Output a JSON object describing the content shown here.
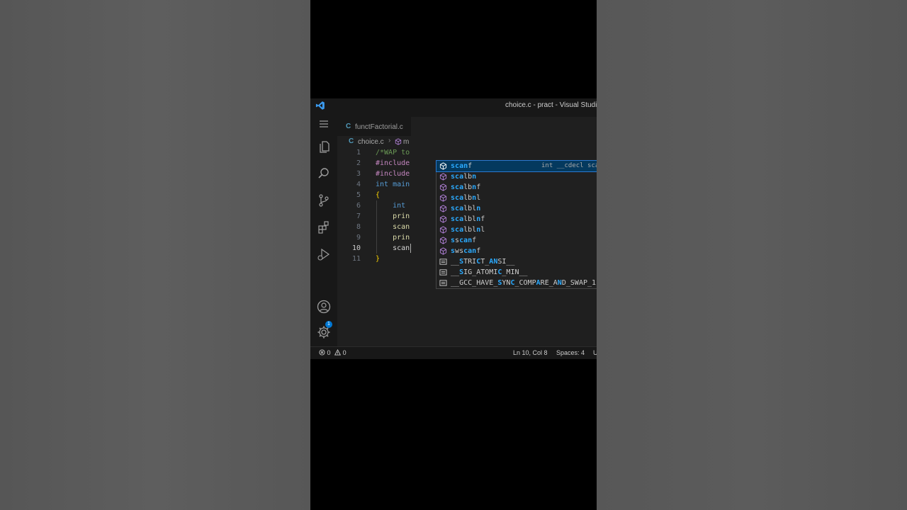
{
  "window": {
    "title": "choice.c - pract - Visual Studio"
  },
  "activity_bar": {
    "items": [
      "files-icon",
      "search-icon",
      "source-control-icon",
      "extensions-icon",
      "run-debug-icon"
    ],
    "bottom_items": [
      "accounts-icon",
      "settings-gear-icon"
    ],
    "accounts_badge": "1"
  },
  "tabs": [
    {
      "label": "functFactorial.c",
      "lang_icon": "C"
    }
  ],
  "breadcrumb": {
    "lang_icon": "C",
    "file": "choice.c",
    "separator": "›",
    "symbol": "m"
  },
  "editor": {
    "lines": [
      {
        "num": "1",
        "text": "/*WAP to"
      },
      {
        "num": "2",
        "text": "#include"
      },
      {
        "num": "3",
        "text": "#include"
      },
      {
        "num": "4",
        "text": "int main"
      },
      {
        "num": "5",
        "text": "{"
      },
      {
        "num": "6",
        "text": "    int"
      },
      {
        "num": "7",
        "text": "    prin"
      },
      {
        "num": "8",
        "text": "    scan"
      },
      {
        "num": "9",
        "text": "    prin"
      },
      {
        "num": "10",
        "text": "    scan"
      },
      {
        "num": "11",
        "text": "}"
      }
    ],
    "active_line": "10"
  },
  "suggestions": {
    "items": [
      {
        "label": "scanf",
        "kind": "function",
        "selected": true
      },
      {
        "label": "scalbn",
        "kind": "function"
      },
      {
        "label": "scalbnf",
        "kind": "function"
      },
      {
        "label": "scalbnl",
        "kind": "function"
      },
      {
        "label": "scalbln",
        "kind": "function"
      },
      {
        "label": "scalblnf",
        "kind": "function"
      },
      {
        "label": "scalblnl",
        "kind": "function"
      },
      {
        "label": "sscanf",
        "kind": "function"
      },
      {
        "label": "swscanf",
        "kind": "function"
      },
      {
        "label": "__STRICT_ANSI__",
        "kind": "macro"
      },
      {
        "label": "__SIG_ATOMIC_MIN__",
        "kind": "macro"
      },
      {
        "label": "__GCC_HAVE_SYNC_COMPARE_AND_SWAP_1",
        "kind": "macro"
      }
    ],
    "selected_detail": "int __cdecl scanf(const"
  },
  "status_bar": {
    "errors": "0",
    "warnings": "0",
    "position": "Ln 10, Col 8",
    "spaces": "Spaces: 4",
    "encoding": "U"
  },
  "colors": {
    "accent": "#0078d4",
    "selection": "#04395e",
    "match_highlight": "#2aaaff"
  }
}
